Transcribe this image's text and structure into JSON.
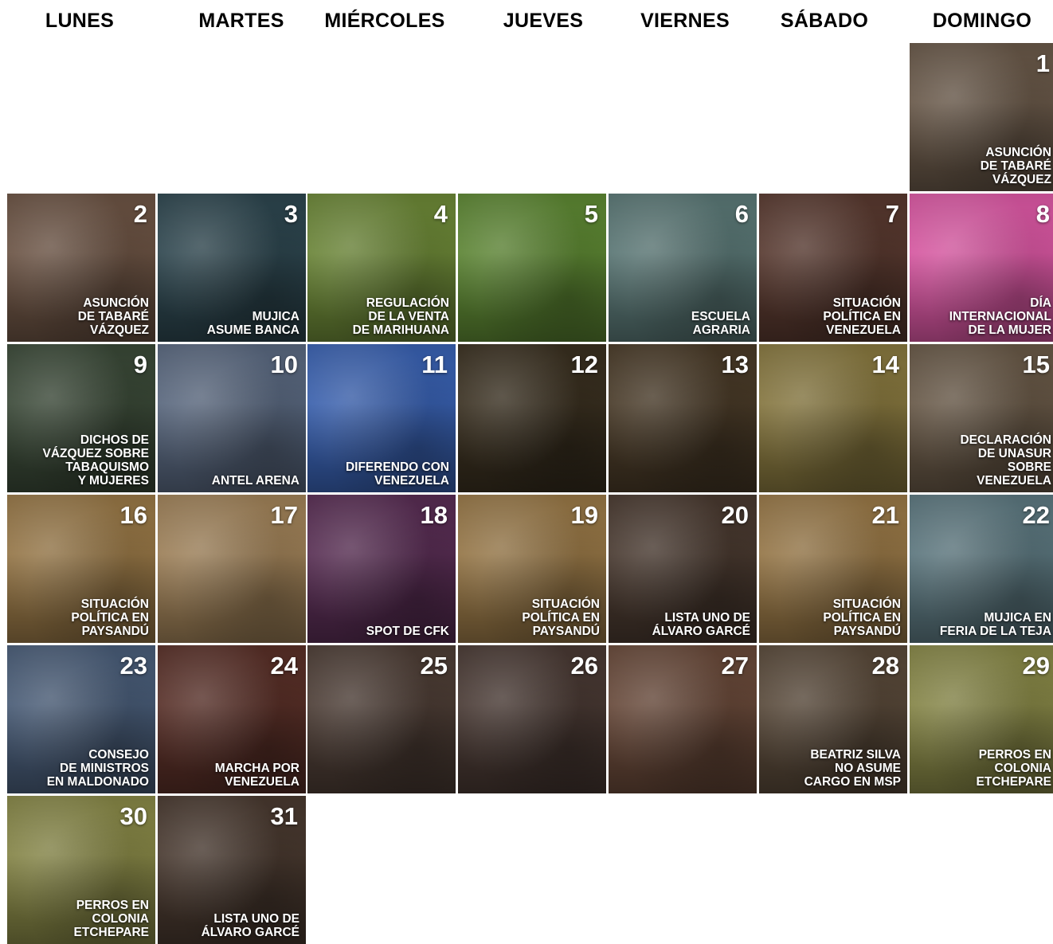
{
  "weekdays": [
    "LUNES",
    "MARTES",
    "MIÉRCOLES",
    "JUEVES",
    "VIERNES",
    "SÁBADO",
    "DOMINGO"
  ],
  "days": [
    {
      "n": "1",
      "caption": "ASUNCIÓN\nDE TABARÉ\nVÁZQUEZ",
      "color": "#6b5a4a",
      "col": 6,
      "row": 0
    },
    {
      "n": "2",
      "caption": "ASUNCIÓN\nDE TABARÉ\nVÁZQUEZ",
      "color": "#6e5545",
      "col": 0,
      "row": 1
    },
    {
      "n": "3",
      "caption": "MUJICA\nASUME BANCA",
      "color": "#2e4750",
      "col": 1,
      "row": 1
    },
    {
      "n": "4",
      "caption": "REGULACIÓN\nDE LA VENTA\nDE MARIHUANA",
      "color": "#6e8a38",
      "col": 2,
      "row": 1
    },
    {
      "n": "5",
      "caption": "",
      "color": "#5f8a34",
      "col": 3,
      "row": 1
    },
    {
      "n": "6",
      "caption": "ESCUELA\nAGRARIA",
      "color": "#5c7a78",
      "col": 4,
      "row": 1
    },
    {
      "n": "7",
      "caption": "SITUACIÓN\nPOLÍTICA EN\nVENEZUELA",
      "color": "#5a3a30",
      "col": 5,
      "row": 1
    },
    {
      "n": "8",
      "caption": "DÍA\nINTERNACIONAL\nDE LA MUJER",
      "color": "#e15aa8",
      "col": 6,
      "row": 1
    },
    {
      "n": "9",
      "caption": "DICHOS DE\nVÁZQUEZ SOBRE\nTABAQUISMO\nY MUJERES",
      "color": "#3b4a38",
      "col": 0,
      "row": 2
    },
    {
      "n": "10",
      "caption": "ANTEL ARENA",
      "color": "#5b6a82",
      "col": 1,
      "row": 2
    },
    {
      "n": "11",
      "caption": "DIFERENDO CON\nVENEZUELA",
      "color": "#3a63b5",
      "col": 2,
      "row": 2
    },
    {
      "n": "12",
      "caption": "",
      "color": "#3a3020",
      "col": 3,
      "row": 2
    },
    {
      "n": "13",
      "caption": "",
      "color": "#4a3b28",
      "col": 4,
      "row": 2
    },
    {
      "n": "14",
      "caption": "",
      "color": "#8a7a40",
      "col": 5,
      "row": 2
    },
    {
      "n": "15",
      "caption": "DECLARACIÓN\nDE UNASUR\nSOBRE\nVENEZUELA",
      "color": "#6a5a48",
      "col": 6,
      "row": 2
    },
    {
      "n": "16",
      "caption": "SITUACIÓN\nPOLÍTICA EN\nPAYSANDÚ",
      "color": "#9b7a48",
      "col": 0,
      "row": 3
    },
    {
      "n": "17",
      "caption": "",
      "color": "#a3845a",
      "col": 1,
      "row": 3
    },
    {
      "n": "18",
      "caption": "SPOT DE CFK",
      "color": "#5a2e55",
      "col": 2,
      "row": 3
    },
    {
      "n": "19",
      "caption": "SITUACIÓN\nPOLÍTICA EN\nPAYSANDÚ",
      "color": "#9b7a48",
      "col": 3,
      "row": 3
    },
    {
      "n": "20",
      "caption": "LISTA UNO DE\nÁLVARO GARCÉ",
      "color": "#4a3a30",
      "col": 4,
      "row": 3
    },
    {
      "n": "21",
      "caption": "SITUACIÓN\nPOLÍTICA EN\nPAYSANDÚ",
      "color": "#9b7a48",
      "col": 5,
      "row": 3
    },
    {
      "n": "22",
      "caption": "MUJICA EN\nFERIA DE LA TEJA",
      "color": "#5e7a82",
      "col": 6,
      "row": 3
    },
    {
      "n": "23",
      "caption": "CONSEJO\nDE MINISTROS\nEN MALDONADO",
      "color": "#4a5e7a",
      "col": 0,
      "row": 4
    },
    {
      "n": "24",
      "caption": "MARCHA POR\nVENEZUELA",
      "color": "#5a3028",
      "col": 1,
      "row": 4
    },
    {
      "n": "25",
      "caption": "",
      "color": "#4e3e36",
      "col": 2,
      "row": 4
    },
    {
      "n": "26",
      "caption": "",
      "color": "#4a3a34",
      "col": 3,
      "row": 4
    },
    {
      "n": "27",
      "caption": "",
      "color": "#6a4a3a",
      "col": 4,
      "row": 4
    },
    {
      "n": "28",
      "caption": "BEATRIZ SILVA\nNO ASUME\nCARGO EN MSP",
      "color": "#5a4a3a",
      "col": 5,
      "row": 4
    },
    {
      "n": "29",
      "caption": "PERROS EN\nCOLONIA\nETCHEPARE",
      "color": "#8a8a48",
      "col": 6,
      "row": 4
    },
    {
      "n": "30",
      "caption": "PERROS EN\nCOLONIA\nETCHEPARE",
      "color": "#8a8a48",
      "col": 0,
      "row": 5
    },
    {
      "n": "31",
      "caption": "LISTA UNO DE\nÁLVARO GARCÉ",
      "color": "#4a3a30",
      "col": 1,
      "row": 5
    }
  ]
}
